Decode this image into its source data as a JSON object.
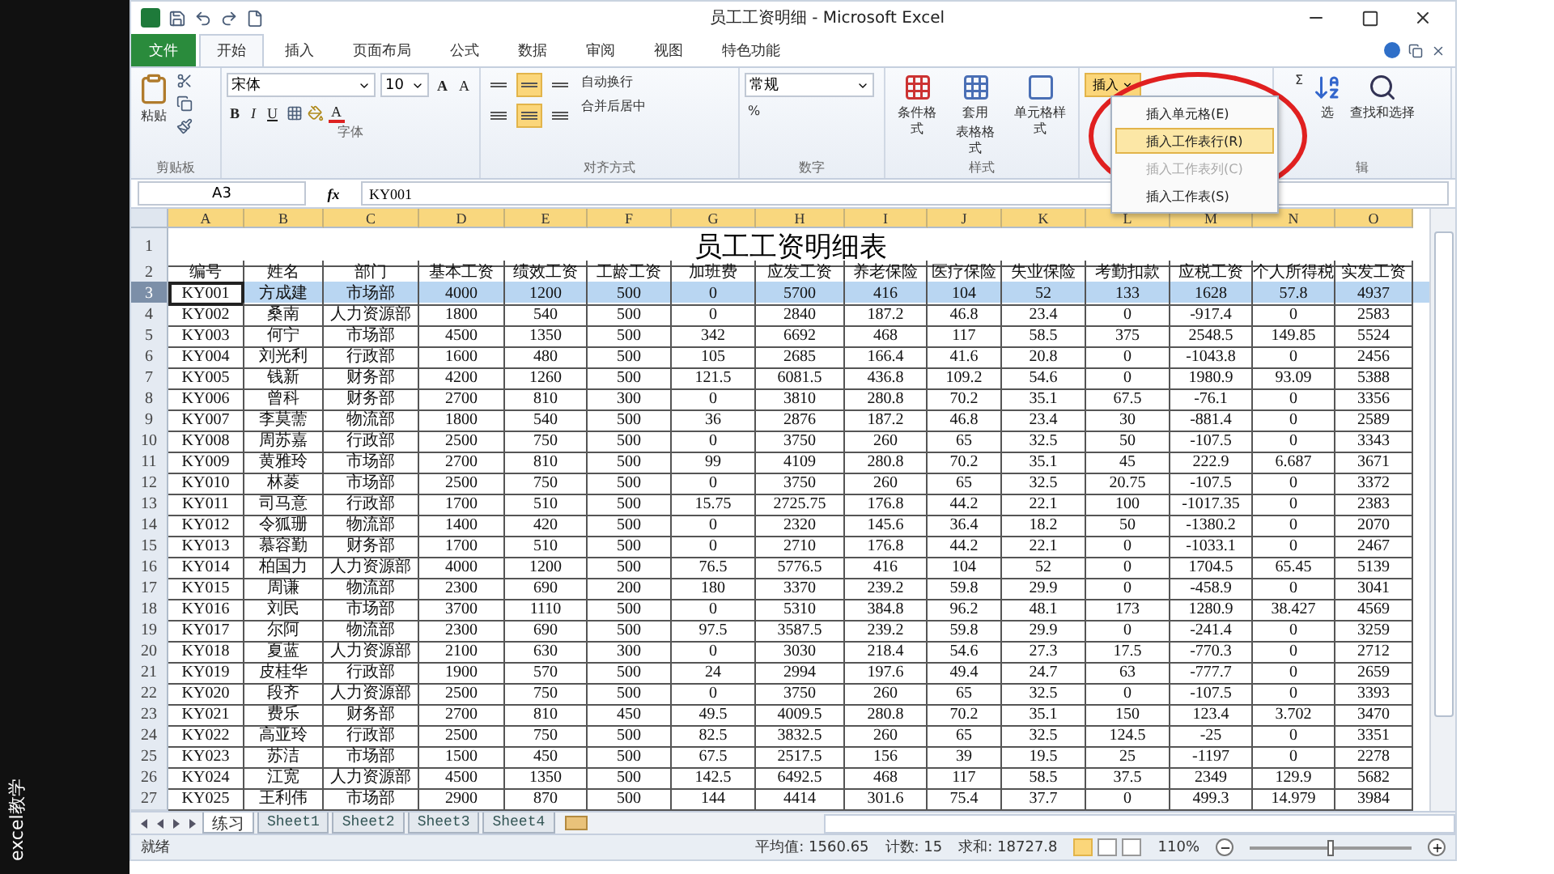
{
  "side_caption": "excel教学",
  "window": {
    "title": "员工工资明细 - Microsoft Excel"
  },
  "ribbon_tabs": [
    {
      "label": "文件",
      "kind": "file",
      "selected": false
    },
    {
      "label": "开始",
      "kind": "tab",
      "selected": true
    },
    {
      "label": "插入",
      "kind": "tab",
      "selected": false
    },
    {
      "label": "页面布局",
      "kind": "tab",
      "selected": false
    },
    {
      "label": "公式",
      "kind": "tab",
      "selected": false
    },
    {
      "label": "数据",
      "kind": "tab",
      "selected": false
    },
    {
      "label": "审阅",
      "kind": "tab",
      "selected": false
    },
    {
      "label": "视图",
      "kind": "tab",
      "selected": false
    },
    {
      "label": "特色功能",
      "kind": "tab",
      "selected": false
    }
  ],
  "clipboard": {
    "paste": "粘贴",
    "label": "剪贴板"
  },
  "font": {
    "name": "宋体",
    "size": "10",
    "bold": "B",
    "italic": "I",
    "underline": "U",
    "font_color": "A",
    "grow": "A",
    "shrink": "A",
    "label": "字体"
  },
  "alignment": {
    "valign": [
      {
        "selected": false
      },
      {
        "selected": true
      },
      {
        "selected": false
      }
    ],
    "halign": [
      {
        "selected": false
      },
      {
        "selected": true
      },
      {
        "selected": false
      }
    ],
    "wrap": "自动换行",
    "merge": "合并后居中",
    "label": "对齐方式"
  },
  "number": {
    "format": "常规",
    "percent": "%",
    "label": "数字"
  },
  "styles": {
    "conditional": "条件格式",
    "table_lines": [
      "套用",
      "表格格式"
    ],
    "cell_styles": "单元格样式",
    "label": "样式"
  },
  "cells": {
    "insert": "插入"
  },
  "editing": {
    "sum": "Σ",
    "sort_tail": "选",
    "find": "查找和选择",
    "label_tail": "辑"
  },
  "menu": {
    "items": [
      {
        "label": "插入单元格(E)",
        "selected": false,
        "disabled": false
      },
      {
        "label": "插入工作表行(R)",
        "selected": true,
        "disabled": false
      },
      {
        "label": "插入工作表列(C)",
        "selected": false,
        "disabled": true
      },
      {
        "label": "插入工作表(S)",
        "selected": false,
        "disabled": false
      }
    ]
  },
  "formula_bar": {
    "name_box": "A3",
    "function_label": "fx",
    "value": "KY001"
  },
  "columns": [
    {
      "label": "A",
      "selected": true
    },
    {
      "label": "B",
      "selected": true
    },
    {
      "label": "C",
      "selected": true
    },
    {
      "label": "D",
      "selected": true
    },
    {
      "label": "E",
      "selected": true
    },
    {
      "label": "F",
      "selected": true
    },
    {
      "label": "G",
      "selected": true
    },
    {
      "label": "H",
      "selected": true
    },
    {
      "label": "I",
      "selected": true
    },
    {
      "label": "J",
      "selected": true
    },
    {
      "label": "K",
      "selected": true
    },
    {
      "label": "L",
      "selected": true
    },
    {
      "label": "M",
      "selected": true
    },
    {
      "label": "N",
      "selected": true
    },
    {
      "label": "O",
      "selected": true
    }
  ],
  "sheet_title": {
    "number": "1",
    "text": "员工工资明细表"
  },
  "header_row": {
    "number": "2",
    "cells": [
      "编号",
      "姓名",
      "部门",
      "基本工资",
      "绩效工资",
      "工龄工资",
      "加班费",
      "应发工资",
      "养老保险",
      "医疗保险",
      "失业保险",
      "考勤扣款",
      "应税工资",
      "个人所得税",
      "实发工资"
    ]
  },
  "rows": [
    {
      "number": "3",
      "selected": true,
      "cells": [
        "KY001",
        "方成建",
        "市场部",
        "4000",
        "1200",
        "500",
        "0",
        "5700",
        "416",
        "104",
        "52",
        "133",
        "1628",
        "57.8",
        "4937"
      ]
    },
    {
      "number": "4",
      "selected": false,
      "cells": [
        "KY002",
        "桑南",
        "人力资源部",
        "1800",
        "540",
        "500",
        "0",
        "2840",
        "187.2",
        "46.8",
        "23.4",
        "0",
        "-917.4",
        "0",
        "2583"
      ]
    },
    {
      "number": "5",
      "selected": false,
      "cells": [
        "KY003",
        "何宁",
        "市场部",
        "4500",
        "1350",
        "500",
        "342",
        "6692",
        "468",
        "117",
        "58.5",
        "375",
        "2548.5",
        "149.85",
        "5524"
      ]
    },
    {
      "number": "6",
      "selected": false,
      "cells": [
        "KY004",
        "刘光利",
        "行政部",
        "1600",
        "480",
        "500",
        "105",
        "2685",
        "166.4",
        "41.6",
        "20.8",
        "0",
        "-1043.8",
        "0",
        "2456"
      ]
    },
    {
      "number": "7",
      "selected": false,
      "cells": [
        "KY005",
        "钱新",
        "财务部",
        "4200",
        "1260",
        "500",
        "121.5",
        "6081.5",
        "436.8",
        "109.2",
        "54.6",
        "0",
        "1980.9",
        "93.09",
        "5388"
      ]
    },
    {
      "number": "8",
      "selected": false,
      "cells": [
        "KY006",
        "曾科",
        "财务部",
        "2700",
        "810",
        "300",
        "0",
        "3810",
        "280.8",
        "70.2",
        "35.1",
        "67.5",
        "-76.1",
        "0",
        "3356"
      ]
    },
    {
      "number": "9",
      "selected": false,
      "cells": [
        "KY007",
        "李莫薷",
        "物流部",
        "1800",
        "540",
        "500",
        "36",
        "2876",
        "187.2",
        "46.8",
        "23.4",
        "30",
        "-881.4",
        "0",
        "2589"
      ]
    },
    {
      "number": "10",
      "selected": false,
      "cells": [
        "KY008",
        "周苏嘉",
        "行政部",
        "2500",
        "750",
        "500",
        "0",
        "3750",
        "260",
        "65",
        "32.5",
        "50",
        "-107.5",
        "0",
        "3343"
      ]
    },
    {
      "number": "11",
      "selected": false,
      "cells": [
        "KY009",
        "黄雅玲",
        "市场部",
        "2700",
        "810",
        "500",
        "99",
        "4109",
        "280.8",
        "70.2",
        "35.1",
        "45",
        "222.9",
        "6.687",
        "3671"
      ]
    },
    {
      "number": "12",
      "selected": false,
      "cells": [
        "KY010",
        "林菱",
        "市场部",
        "2500",
        "750",
        "500",
        "0",
        "3750",
        "260",
        "65",
        "32.5",
        "20.75",
        "-107.5",
        "0",
        "3372"
      ]
    },
    {
      "number": "13",
      "selected": false,
      "cells": [
        "KY011",
        "司马意",
        "行政部",
        "1700",
        "510",
        "500",
        "15.75",
        "2725.75",
        "176.8",
        "44.2",
        "22.1",
        "100",
        "-1017.35",
        "0",
        "2383"
      ]
    },
    {
      "number": "14",
      "selected": false,
      "cells": [
        "KY012",
        "令狐珊",
        "物流部",
        "1400",
        "420",
        "500",
        "0",
        "2320",
        "145.6",
        "36.4",
        "18.2",
        "50",
        "-1380.2",
        "0",
        "2070"
      ]
    },
    {
      "number": "15",
      "selected": false,
      "cells": [
        "KY013",
        "慕容勤",
        "财务部",
        "1700",
        "510",
        "500",
        "0",
        "2710",
        "176.8",
        "44.2",
        "22.1",
        "0",
        "-1033.1",
        "0",
        "2467"
      ]
    },
    {
      "number": "16",
      "selected": false,
      "cells": [
        "KY014",
        "柏国力",
        "人力资源部",
        "4000",
        "1200",
        "500",
        "76.5",
        "5776.5",
        "416",
        "104",
        "52",
        "0",
        "1704.5",
        "65.45",
        "5139"
      ]
    },
    {
      "number": "17",
      "selected": false,
      "cells": [
        "KY015",
        "周谦",
        "物流部",
        "2300",
        "690",
        "200",
        "180",
        "3370",
        "239.2",
        "59.8",
        "29.9",
        "0",
        "-458.9",
        "0",
        "3041"
      ]
    },
    {
      "number": "18",
      "selected": false,
      "cells": [
        "KY016",
        "刘民",
        "市场部",
        "3700",
        "1110",
        "500",
        "0",
        "5310",
        "384.8",
        "96.2",
        "48.1",
        "173",
        "1280.9",
        "38.427",
        "4569"
      ]
    },
    {
      "number": "19",
      "selected": false,
      "cells": [
        "KY017",
        "尔阿",
        "物流部",
        "2300",
        "690",
        "500",
        "97.5",
        "3587.5",
        "239.2",
        "59.8",
        "29.9",
        "0",
        "-241.4",
        "0",
        "3259"
      ]
    },
    {
      "number": "20",
      "selected": false,
      "cells": [
        "KY018",
        "夏蓝",
        "人力资源部",
        "2100",
        "630",
        "300",
        "0",
        "3030",
        "218.4",
        "54.6",
        "27.3",
        "17.5",
        "-770.3",
        "0",
        "2712"
      ]
    },
    {
      "number": "21",
      "selected": false,
      "cells": [
        "KY019",
        "皮桂华",
        "行政部",
        "1900",
        "570",
        "500",
        "24",
        "2994",
        "197.6",
        "49.4",
        "24.7",
        "63",
        "-777.7",
        "0",
        "2659"
      ]
    },
    {
      "number": "22",
      "selected": false,
      "cells": [
        "KY020",
        "段齐",
        "人力资源部",
        "2500",
        "750",
        "500",
        "0",
        "3750",
        "260",
        "65",
        "32.5",
        "0",
        "-107.5",
        "0",
        "3393"
      ]
    },
    {
      "number": "23",
      "selected": false,
      "cells": [
        "KY021",
        "费乐",
        "财务部",
        "2700",
        "810",
        "450",
        "49.5",
        "4009.5",
        "280.8",
        "70.2",
        "35.1",
        "150",
        "123.4",
        "3.702",
        "3470"
      ]
    },
    {
      "number": "24",
      "selected": false,
      "cells": [
        "KY022",
        "高亚玲",
        "行政部",
        "2500",
        "750",
        "500",
        "82.5",
        "3832.5",
        "260",
        "65",
        "32.5",
        "124.5",
        "-25",
        "0",
        "3351"
      ]
    },
    {
      "number": "25",
      "selected": false,
      "cells": [
        "KY023",
        "苏洁",
        "市场部",
        "1500",
        "450",
        "500",
        "67.5",
        "2517.5",
        "156",
        "39",
        "19.5",
        "25",
        "-1197",
        "0",
        "2278"
      ]
    },
    {
      "number": "26",
      "selected": false,
      "cells": [
        "KY024",
        "江宽",
        "人力资源部",
        "4500",
        "1350",
        "500",
        "142.5",
        "6492.5",
        "468",
        "117",
        "58.5",
        "37.5",
        "2349",
        "129.9",
        "5682"
      ]
    },
    {
      "number": "27",
      "selected": false,
      "cells": [
        "KY025",
        "王利伟",
        "市场部",
        "2900",
        "870",
        "500",
        "144",
        "4414",
        "301.6",
        "75.4",
        "37.7",
        "0",
        "499.3",
        "14.979",
        "3984"
      ]
    }
  ],
  "sheet_tabs": [
    {
      "label": "练习",
      "selected": true
    },
    {
      "label": "Sheet1",
      "selected": false
    },
    {
      "label": "Sheet2",
      "selected": false
    },
    {
      "label": "Sheet3",
      "selected": false
    },
    {
      "label": "Sheet4",
      "selected": false
    }
  ],
  "status": {
    "ready": "就绪",
    "average": "平均值: 1560.65",
    "count": "计数: 15",
    "sum": "求和: 18727.8",
    "zoom": "110%",
    "zoom_slider": {
      "level": 0.5
    },
    "views": [
      {
        "selected": true
      },
      {
        "selected": false
      },
      {
        "selected": false
      }
    ]
  }
}
